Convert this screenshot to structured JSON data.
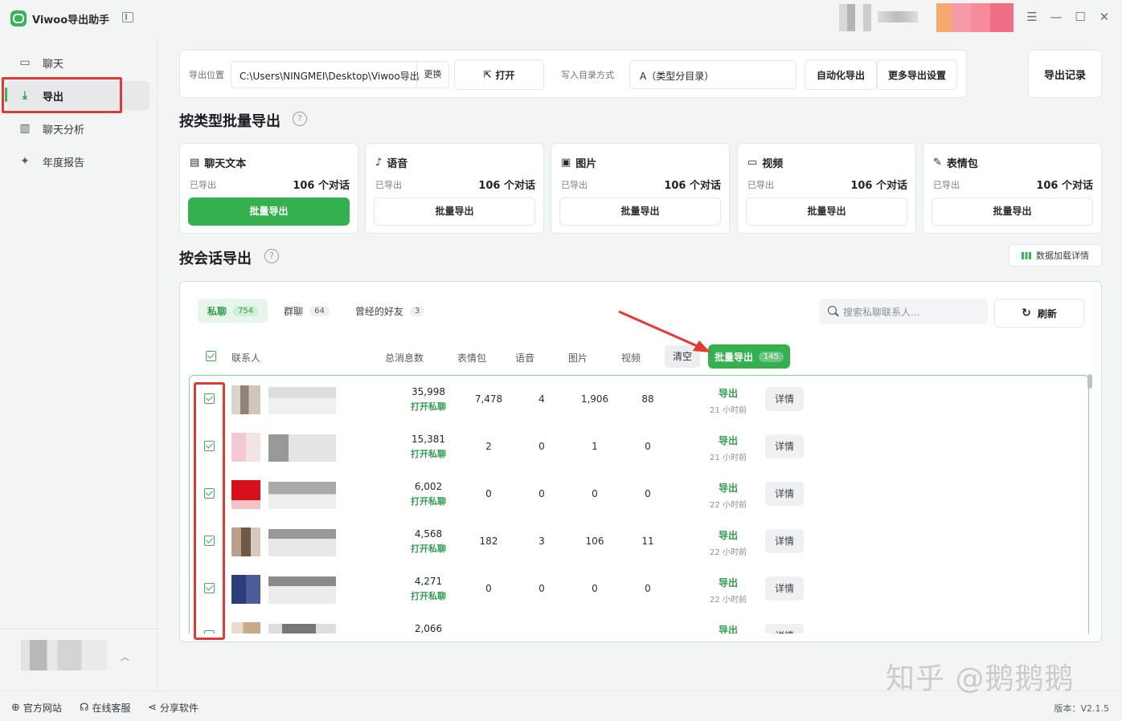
{
  "app": {
    "title": "Viwoo导出助手"
  },
  "sidebar": {
    "items": [
      {
        "label": "聊天",
        "icon": "chat-icon"
      },
      {
        "label": "导出",
        "icon": "download-icon"
      },
      {
        "label": "聊天分析",
        "icon": "bar-chart-icon"
      },
      {
        "label": "年度报告",
        "icon": "sparkle-icon"
      }
    ]
  },
  "toolbar": {
    "path_label": "导出位置",
    "path": "C:\\Users\\NINGMEI\\Desktop\\Viwoo导出",
    "change": "更换",
    "open": "打开",
    "dir_mode_label": "写入目录方式",
    "dir_mode": "A（类型分目录）",
    "auto_export": "自动化导出",
    "more_settings": "更多导出设置",
    "history": "导出记录"
  },
  "by_type": {
    "title": "按类型批量导出",
    "cards": [
      {
        "title": "聊天文本",
        "status": "已导出",
        "count": "106 个对话",
        "button": "批量导出",
        "icon": "message-icon"
      },
      {
        "title": "语音",
        "status": "已导出",
        "count": "106 个对话",
        "button": "批量导出",
        "icon": "mic-icon"
      },
      {
        "title": "图片",
        "status": "已导出",
        "count": "106 个对话",
        "button": "批量导出",
        "icon": "image-icon"
      },
      {
        "title": "视频",
        "status": "已导出",
        "count": "106 个对话",
        "button": "批量导出",
        "icon": "video-icon"
      },
      {
        "title": "表情包",
        "status": "已导出",
        "count": "106 个对话",
        "button": "批量导出",
        "icon": "magic-icon"
      }
    ]
  },
  "by_session": {
    "title": "按会话导出",
    "load_detail": "数据加载详情",
    "tabs": [
      {
        "label": "私聊",
        "count": "754"
      },
      {
        "label": "群聊",
        "count": "64"
      },
      {
        "label": "曾经的好友",
        "count": "3"
      }
    ],
    "search_placeholder": "搜索私聊联系人...",
    "refresh": "刷新",
    "columns": {
      "contact": "联系人",
      "total": "总消息数",
      "sticker": "表情包",
      "voice": "语音",
      "image": "图片",
      "video": "视频"
    },
    "clear": "清空",
    "batch_export": "批量导出",
    "batch_count": "145",
    "rows": [
      {
        "total": "35,998",
        "open": "打开私聊",
        "sticker": "7,478",
        "voice": "4",
        "image": "1,906",
        "video": "88",
        "export": "导出",
        "time": "21 小时前",
        "detail": "详情"
      },
      {
        "total": "15,381",
        "open": "打开私聊",
        "sticker": "2",
        "voice": "0",
        "image": "1",
        "video": "0",
        "export": "导出",
        "time": "21 小时前",
        "detail": "详情"
      },
      {
        "total": "6,002",
        "open": "打开私聊",
        "sticker": "0",
        "voice": "0",
        "image": "0",
        "video": "0",
        "export": "导出",
        "time": "22 小时前",
        "detail": "详情"
      },
      {
        "total": "4,568",
        "open": "打开私聊",
        "sticker": "182",
        "voice": "3",
        "image": "106",
        "video": "11",
        "export": "导出",
        "time": "22 小时前",
        "detail": "详情"
      },
      {
        "total": "4,271",
        "open": "打开私聊",
        "sticker": "0",
        "voice": "0",
        "image": "0",
        "video": "0",
        "export": "导出",
        "time": "22 小时前",
        "detail": "详情"
      },
      {
        "total": "2,066",
        "open": "",
        "sticker": "",
        "voice": "",
        "image": "",
        "video": "",
        "export": "导出",
        "time": "",
        "detail": "详情"
      }
    ]
  },
  "footer": {
    "website": "官方网站",
    "support": "在线客服",
    "share": "分享软件",
    "version": "版本：V2.1.5"
  },
  "watermark": "知乎 @鹅鹅鹅",
  "colors": {
    "accent": "#35b04f",
    "highlight": "#e53935"
  }
}
